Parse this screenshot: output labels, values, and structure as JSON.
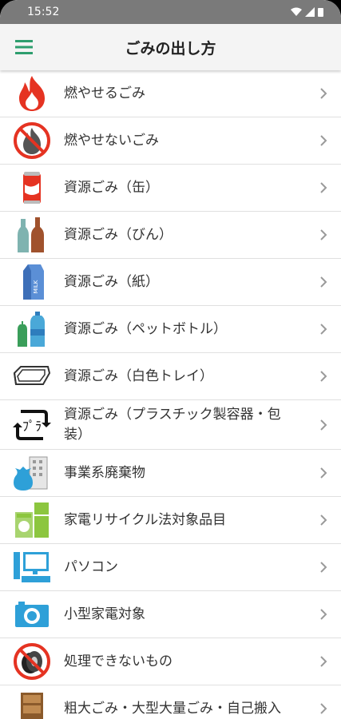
{
  "status": {
    "time": "15:52"
  },
  "app_bar": {
    "title": "ごみの出し方",
    "menu_icon": "hamburger-menu-icon"
  },
  "colors": {
    "accent": "#2e9e6e",
    "chevron": "#9a9a9a"
  },
  "items": [
    {
      "label": "燃やせるごみ",
      "icon": "fire-icon"
    },
    {
      "label": "燃やせないごみ",
      "icon": "no-fire-icon"
    },
    {
      "label": "資源ごみ（缶）",
      "icon": "can-icon"
    },
    {
      "label": "資源ごみ（びん）",
      "icon": "bottle-icon"
    },
    {
      "label": "資源ごみ（紙）",
      "icon": "milk-carton-icon"
    },
    {
      "label": "資源ごみ（ペットボトル）",
      "icon": "pet-bottle-icon"
    },
    {
      "label": "資源ごみ（白色トレイ）",
      "icon": "tray-icon"
    },
    {
      "label": "資源ごみ（プラスチック製容器・包装）",
      "icon": "plastic-recycle-icon"
    },
    {
      "label": "事業系廃棄物",
      "icon": "business-waste-icon"
    },
    {
      "label": "家電リサイクル法対象品目",
      "icon": "appliance-icon"
    },
    {
      "label": "パソコン",
      "icon": "computer-icon"
    },
    {
      "label": "小型家電対象",
      "icon": "camera-icon"
    },
    {
      "label": "処理できないもの",
      "icon": "prohibited-tire-icon"
    },
    {
      "label": "粗大ごみ・大型大量ごみ・自己搬入",
      "icon": "furniture-icon"
    }
  ]
}
